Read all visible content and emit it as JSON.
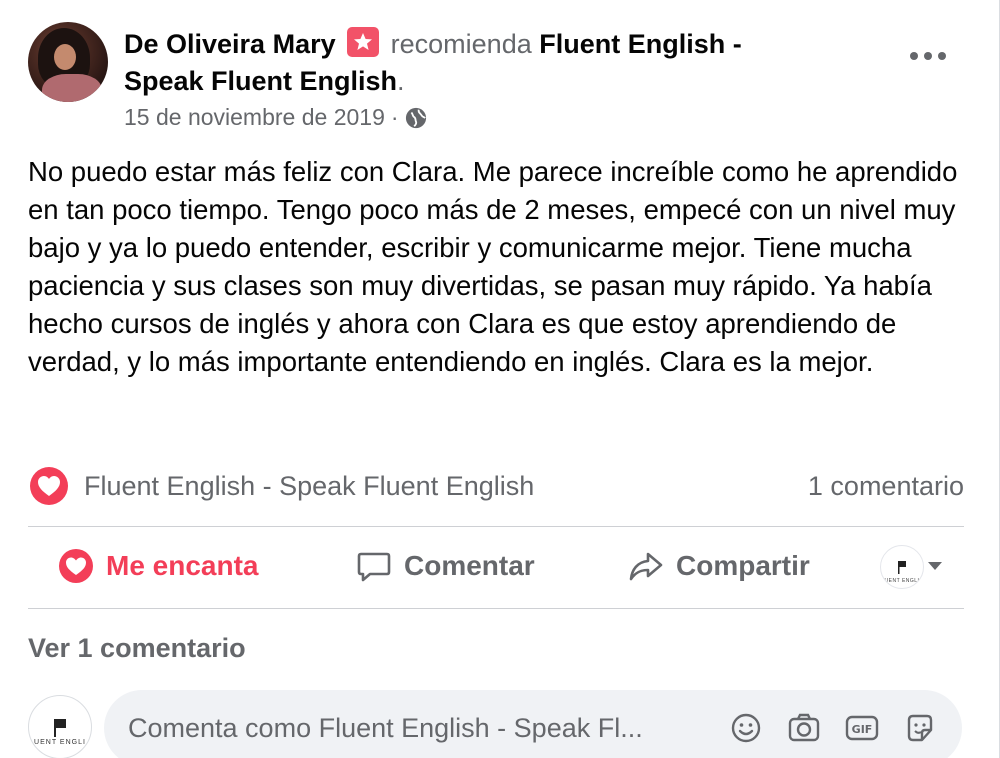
{
  "post": {
    "author": "De Oliveira Mary",
    "verb": " recomienda ",
    "page_name": "Fluent English - Speak Fluent English",
    "end_punct": ".",
    "date": "15 de noviembre de 2019",
    "date_sep": "·",
    "body": "No puedo estar más feliz con Clara. Me parece increíble como he aprendido en tan poco tiempo. Tengo poco más de 2 meses, empecé con un nivel muy bajo y ya lo puedo entender, escribir y comunicarme mejor. Tiene mucha paciencia y sus clases son muy divertidas, se pasan muy rápido. Ya había hecho cursos de inglés y ahora con Clara es que estoy aprendiendo de verdad, y lo más importante entendiendo en inglés. Clara es la mejor."
  },
  "reactions": {
    "reactor": "Fluent English - Speak Fluent English",
    "comment_count": "1 comentario"
  },
  "actions": {
    "love": "Me encanta",
    "comment": "Comentar",
    "share": "Compartir",
    "page_avatar_text": "UENT ENGLI"
  },
  "comments": {
    "view_label": "Ver 1 comentario",
    "placeholder": "Comenta como Fluent English - Speak Fl...",
    "avatar_text": "UENT ENGLI"
  },
  "colors": {
    "love": "#f33e58",
    "secondary_text": "#65676b",
    "input_bg": "#f0f2f5"
  },
  "icons": [
    "recommend-badge-icon",
    "globe-icon",
    "more-options-icon",
    "heart-icon",
    "comment-icon",
    "share-icon",
    "emoji-icon",
    "camera-icon",
    "gif-icon",
    "sticker-icon"
  ]
}
